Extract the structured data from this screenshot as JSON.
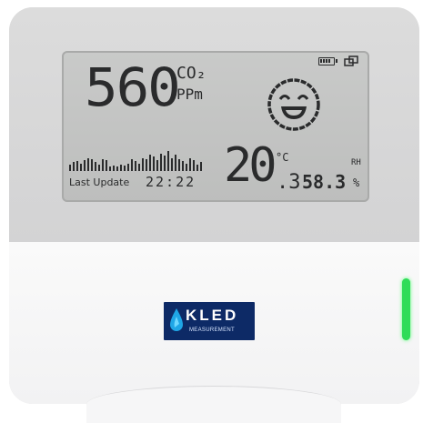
{
  "display": {
    "co2_value": "560",
    "co2_unit_top": "CO₂",
    "co2_unit_bottom": "PPm",
    "temp_int": "20",
    "temp_dec": ".3",
    "temp_unit": "°C",
    "rh_value": "58.3",
    "rh_label": "RH",
    "rh_unit": "%",
    "last_update_label": "Last Update",
    "last_update_time": "22:22",
    "air_quality": "happy-face-icon",
    "battery_level": 0.8
  },
  "logo": {
    "name": "KLED",
    "sub": "MEASUREMENT"
  },
  "status_led": {
    "color": "#2fdc58",
    "state": "on"
  },
  "history_bars": [
    0.3,
    0.4,
    0.45,
    0.35,
    0.5,
    0.6,
    0.55,
    0.4,
    0.3,
    0.55,
    0.5,
    0.2,
    0.25,
    0.2,
    0.3,
    0.25,
    0.35,
    0.55,
    0.45,
    0.35,
    0.6,
    0.55,
    0.75,
    0.65,
    0.5,
    0.8,
    0.7,
    0.9,
    0.6,
    0.75,
    0.55,
    0.45,
    0.35,
    0.6,
    0.5,
    0.3,
    0.4
  ]
}
